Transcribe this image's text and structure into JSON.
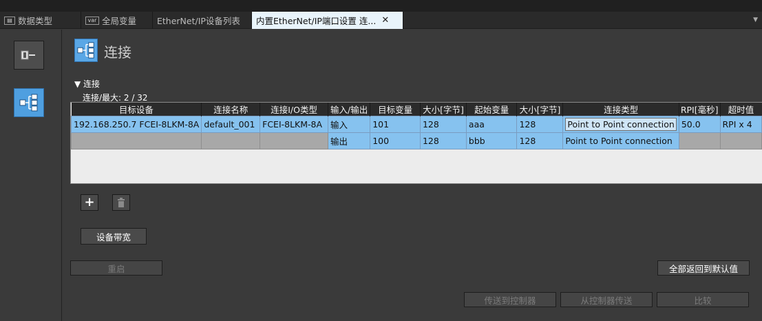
{
  "tabs": [
    {
      "label": "数据类型",
      "icon": "datatype-icon"
    },
    {
      "label": "全局变量",
      "icon": "var-icon",
      "icon_text": "var"
    },
    {
      "label": "EtherNet/IP设备列表"
    },
    {
      "label": "内置EtherNet/IP端口设置 连...",
      "active": true,
      "close": "✕"
    }
  ],
  "header": {
    "title": "连接"
  },
  "section": {
    "title": "▼ 连接",
    "count": "连接/最大: 2 / 32"
  },
  "table": {
    "columns": [
      "目标设备",
      "连接名称",
      "连接I/O类型",
      "输入/输出",
      "目标变量",
      "大小[字节]",
      "起始变量",
      "大小[字节]",
      "连接类型",
      "RPI[毫秒]",
      "超时值"
    ],
    "rows": [
      [
        "192.168.250.7 FCEI-8LKM-8A",
        "default_001",
        "FCEI-8LKM-8A",
        "输入",
        "101",
        "128",
        "aaa",
        "128",
        "Point to Point connection",
        "50.0",
        "RPI x 4"
      ],
      [
        "",
        "",
        "",
        "输出",
        "100",
        "128",
        "bbb",
        "128",
        "Point to Point connection",
        "",
        ""
      ]
    ]
  },
  "buttons": {
    "add": "+",
    "delete": "🗑",
    "bandwidth": "设备带宽",
    "restart": "重启",
    "reset_defaults": "全部返回到默认值",
    "transfer_to": "传送到控制器",
    "transfer_from": "从控制器传送",
    "compare": "比较"
  },
  "colors": {
    "accent": "#86c2ef",
    "active_tab": "#e9f4fb",
    "background": "#3a3a3a"
  }
}
